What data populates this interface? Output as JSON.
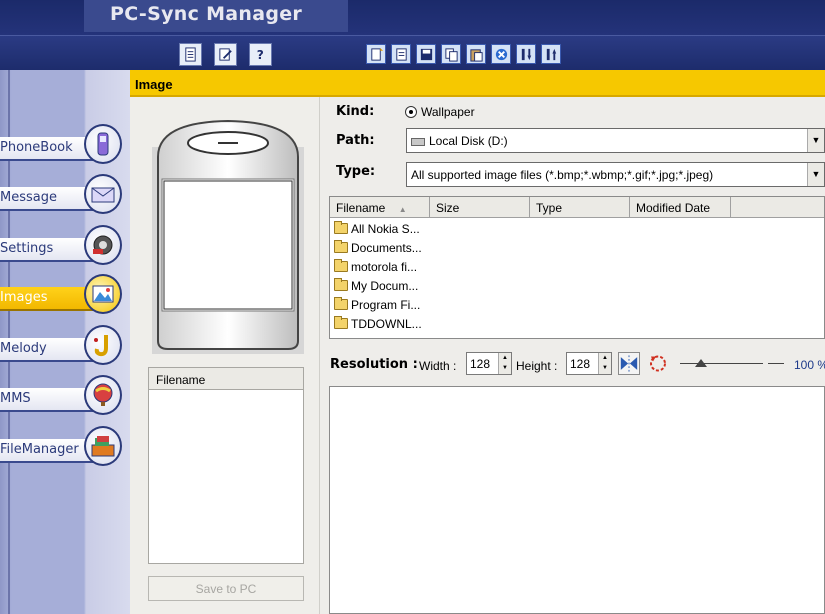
{
  "app": {
    "title": "PC-Sync Manager"
  },
  "toolbar": {
    "left_icons": [
      "document-icon",
      "edit-icon",
      "help-icon"
    ],
    "right_icons": [
      "new-icon",
      "open-icon",
      "save-icon",
      "copy-icon",
      "paste-icon",
      "stop-icon",
      "move-down-icon",
      "move-up-icon"
    ]
  },
  "sidebar": {
    "items": [
      {
        "label": "PhoneBook",
        "icon": "phone-icon",
        "active": false
      },
      {
        "label": "Message",
        "icon": "envelope-icon",
        "active": false
      },
      {
        "label": "Settings",
        "icon": "settings-icon",
        "active": false
      },
      {
        "label": "Images",
        "icon": "images-icon",
        "active": true
      },
      {
        "label": "Melody",
        "icon": "saxophone-icon",
        "active": false
      },
      {
        "label": "MMS",
        "icon": "balloon-icon",
        "active": false
      },
      {
        "label": "FileManager",
        "icon": "folders-icon",
        "active": false
      }
    ]
  },
  "header": {
    "title": "Image"
  },
  "left_panel": {
    "filename_header": "Filename",
    "save_button": "Save to PC"
  },
  "form": {
    "kind_label": "Kind:",
    "kind_value": "Wallpaper",
    "path_label": "Path:",
    "path_value": "Local Disk (D:)",
    "type_label": "Type:",
    "type_value": "All supported image files (*.bmp;*.wbmp;*.gif;*.jpg;*.jpeg)"
  },
  "file_list": {
    "columns": [
      "Filename",
      "Size",
      "Type",
      "Modified Date"
    ],
    "rows": [
      "All Nokia S...",
      "Documents...",
      "motorola fi...",
      "My Docum...",
      "Program Fi...",
      "TDDOWNL..."
    ]
  },
  "resolution": {
    "label": "Resolution :",
    "width_label": "Width :",
    "width_value": "128",
    "height_label": "Height :",
    "height_value": "128",
    "zoom_text": "100 %",
    "zoom_level": 0.25
  },
  "colors": {
    "accent": "#f6c800",
    "brand": "#1d2c6c"
  }
}
